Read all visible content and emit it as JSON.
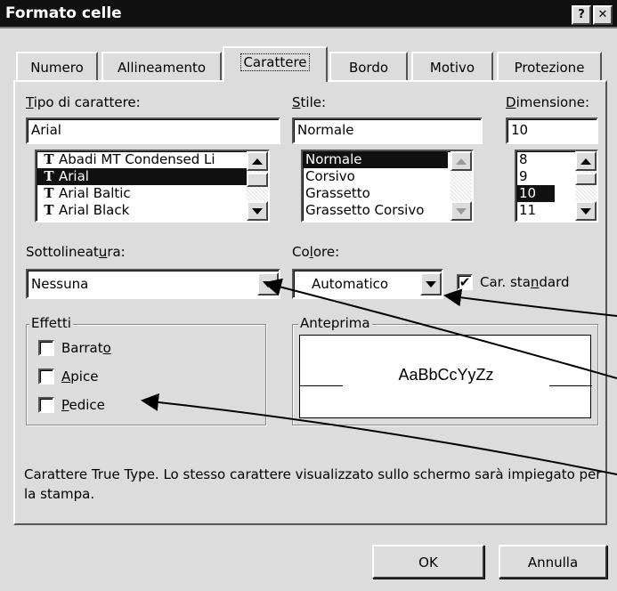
{
  "window": {
    "title": "Formato celle",
    "help_btn": "?",
    "close_btn": "✕"
  },
  "tabs": [
    {
      "label": "Numero"
    },
    {
      "label": "Allineamento"
    },
    {
      "label": "Carattere"
    },
    {
      "label": "Bordo"
    },
    {
      "label": "Motivo"
    },
    {
      "label": "Protezione"
    }
  ],
  "font": {
    "label_u": "T",
    "label_rest": "ipo di carattere:",
    "value": "Arial",
    "items": [
      "Abadi MT Condensed Li",
      "Arial",
      "Arial Baltic",
      "Arial Black"
    ],
    "selected": 1,
    "icon_glyph": "T"
  },
  "style": {
    "label_u": "S",
    "label_rest": "tile:",
    "value": "Normale",
    "items": [
      "Normale",
      "Corsivo",
      "Grassetto",
      "Grassetto Corsivo"
    ]
  },
  "size": {
    "label_u": "D",
    "label_rest": "imensione:",
    "value": "10",
    "items": [
      "8",
      "9",
      "10",
      "11"
    ]
  },
  "underline": {
    "label_a": "Sottolineat",
    "label_u": "u",
    "label_b": "ra:",
    "value": "Nessuna"
  },
  "color": {
    "label_a": "Co",
    "label_u": "l",
    "label_b": "ore:",
    "value": "Automatico"
  },
  "standard": {
    "label_a": "Car. sta",
    "label_u": "n",
    "label_b": "dard",
    "check": "✔"
  },
  "effects": {
    "title": "Effetti",
    "items": [
      {
        "a": "Barrat",
        "u": "o",
        "b": ""
      },
      {
        "a": "",
        "u": "A",
        "b": "pice"
      },
      {
        "a": "",
        "u": "P",
        "b": "edice"
      }
    ]
  },
  "preview": {
    "title": "Anteprima",
    "sample": "AaBbCcYyZz"
  },
  "description": "Carattere True Type. Lo stesso carattere visualizzato sullo schermo sarà impiegato per la stampa.",
  "buttons": {
    "ok": "OK",
    "cancel": "Annulla"
  }
}
